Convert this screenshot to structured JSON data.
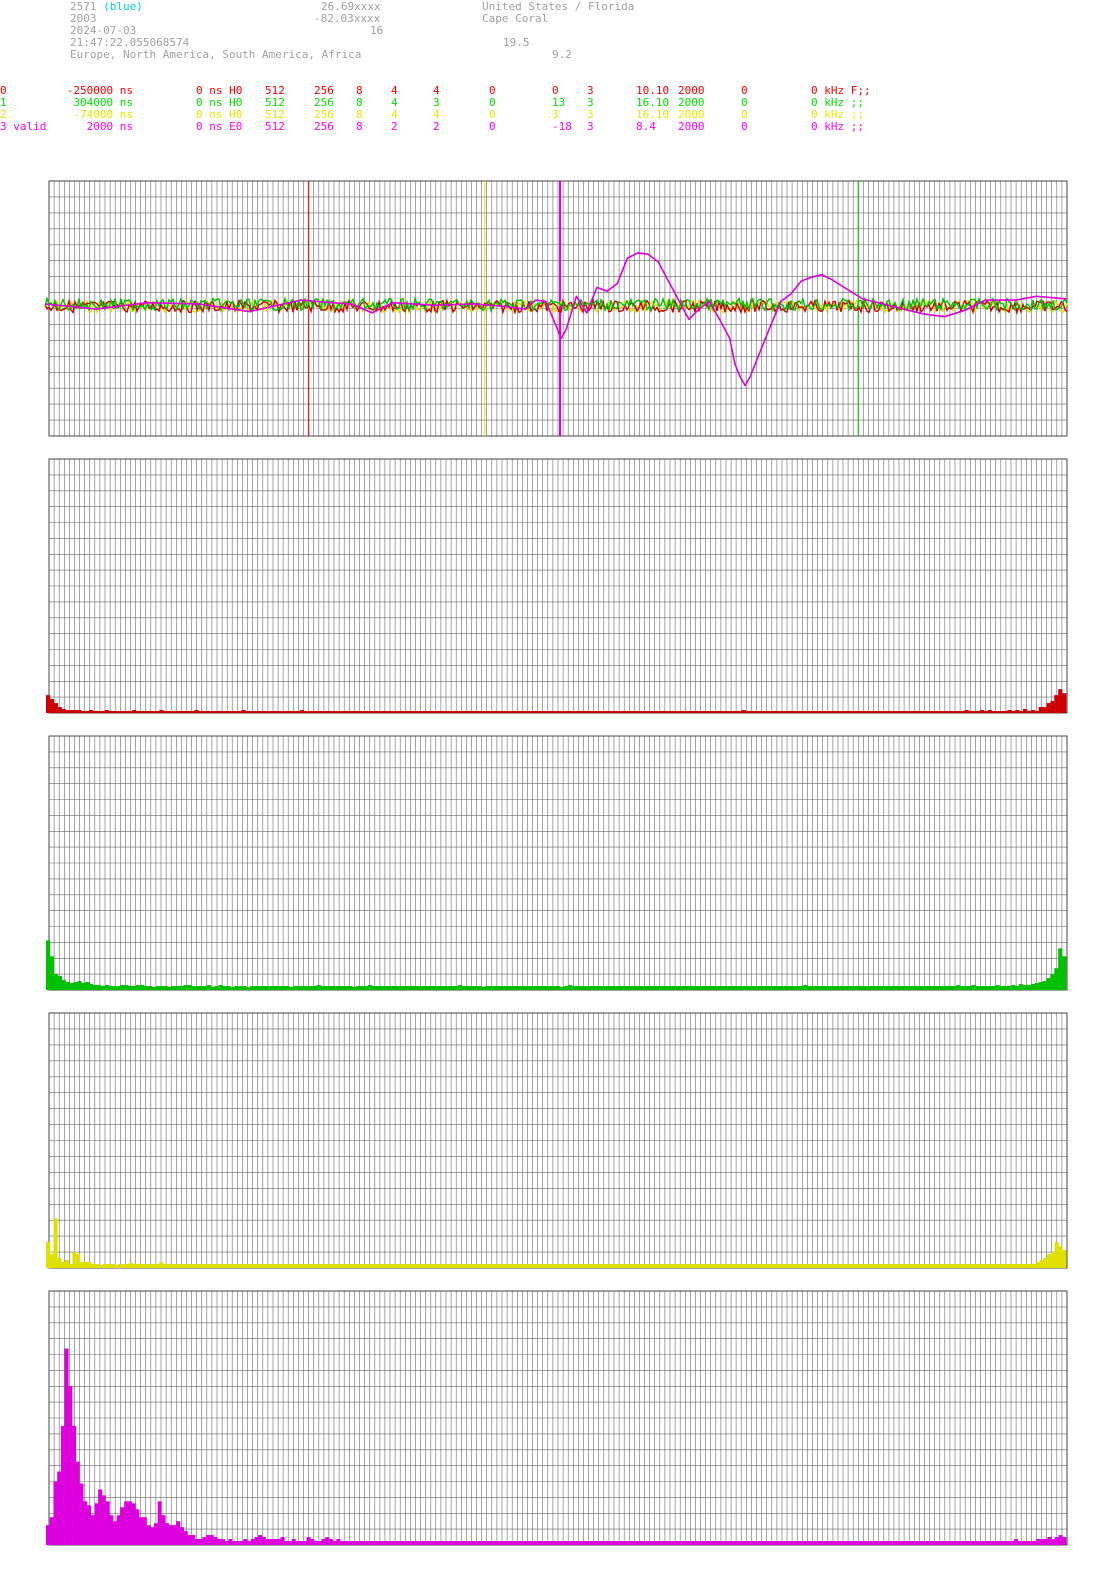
{
  "header": {
    "station_id": "2571",
    "station_tag": "(blue)",
    "station_num": "2003",
    "date": "2024-07-03",
    "time": "21:47:22.055068574",
    "regions": "Europe, North America, South America, Africa",
    "lat": "26.69xxxx",
    "lon": "-82.03xxxx",
    "val_a": "16",
    "country": "United States / Florida",
    "city": "Cape Coral",
    "val_b": "19.5",
    "val_c": "9.2"
  },
  "channels": [
    {
      "color": "#ff0000",
      "label": "0",
      "offset": "-250000 ns",
      "shift": "0 ns H0",
      "c1": "512",
      "c2": "256",
      "c3": "8",
      "c4": "4",
      "c5": "4",
      "c6": "0",
      "c7": "0",
      "c8": "3",
      "freq": "10.10",
      "bw": "2000",
      "c9": "0",
      "tail": "0 kHz F;;"
    },
    {
      "color": "#00e000",
      "label": "1",
      "offset": "304000 ns",
      "shift": "0 ns H0",
      "c1": "512",
      "c2": "256",
      "c3": "8",
      "c4": "4",
      "c5": "3",
      "c6": "0",
      "c7": "13",
      "c8": "3",
      "freq": "16.10",
      "bw": "2000",
      "c9": "0",
      "tail": "0 kHz ;;"
    },
    {
      "color": "#e8e800",
      "label": "2",
      "offset": "-74000 ns",
      "shift": "0 ns H0",
      "c1": "512",
      "c2": "256",
      "c3": "8",
      "c4": "4",
      "c5": "4",
      "c6": "0",
      "c7": "3",
      "c8": "3",
      "freq": "16.10",
      "bw": "2000",
      "c9": "0",
      "tail": "0 kHz ;;"
    },
    {
      "color": "#ff00ff",
      "label": "3 valid",
      "offset": "2000 ns",
      "shift": "0 ns E0",
      "c1": "512",
      "c2": "256",
      "c3": "8",
      "c4": "2",
      "c5": "2",
      "c6": "0",
      "c7": "-18",
      "c8": "3",
      "freq": "8.4",
      "bw": "2000",
      "c9": "0",
      "tail": "0 kHz ;;"
    }
  ],
  "colors": {
    "ch0": "#cc0000",
    "ch1": "#00c000",
    "ch2": "#e0e000",
    "ch3": "#dd00dd",
    "grid": "#555555",
    "bg": "#ffffff"
  },
  "chart_data": [
    {
      "type": "line",
      "markers": [
        {
          "channel": 0,
          "pos": 0.255
        },
        {
          "channel": 2,
          "pos": 0.428
        },
        {
          "channel": 3,
          "pos": 0.502
        },
        {
          "channel": 1,
          "pos": 0.795
        }
      ],
      "series": [
        {
          "channel": 3,
          "points": [
            [
              0,
              0.02
            ],
            [
              0.05,
              -0.02
            ],
            [
              0.1,
              0.03
            ],
            [
              0.15,
              0.02
            ],
            [
              0.2,
              -0.04
            ],
            [
              0.25,
              0.05
            ],
            [
              0.28,
              0.03
            ],
            [
              0.3,
              0.02
            ],
            [
              0.32,
              -0.05
            ],
            [
              0.34,
              0.03
            ],
            [
              0.38,
              0.01
            ],
            [
              0.42,
              0.02
            ],
            [
              0.45,
              0.0
            ],
            [
              0.47,
              -0.02
            ],
            [
              0.48,
              0.05
            ],
            [
              0.49,
              0.04
            ],
            [
              0.5,
              -0.15
            ],
            [
              0.505,
              -0.25
            ],
            [
              0.51,
              -0.18
            ],
            [
              0.52,
              0.08
            ],
            [
              0.53,
              -0.05
            ],
            [
              0.54,
              0.15
            ],
            [
              0.55,
              0.12
            ],
            [
              0.56,
              0.18
            ],
            [
              0.57,
              0.38
            ],
            [
              0.58,
              0.42
            ],
            [
              0.59,
              0.41
            ],
            [
              0.6,
              0.35
            ],
            [
              0.61,
              0.2
            ],
            [
              0.62,
              0.05
            ],
            [
              0.63,
              -0.1
            ],
            [
              0.64,
              -0.02
            ],
            [
              0.65,
              0.04
            ],
            [
              0.66,
              -0.1
            ],
            [
              0.67,
              -0.25
            ],
            [
              0.675,
              -0.45
            ],
            [
              0.68,
              -0.55
            ],
            [
              0.685,
              -0.62
            ],
            [
              0.69,
              -0.55
            ],
            [
              0.7,
              -0.35
            ],
            [
              0.71,
              -0.15
            ],
            [
              0.72,
              0.04
            ],
            [
              0.73,
              0.1
            ],
            [
              0.74,
              0.2
            ],
            [
              0.75,
              0.23
            ],
            [
              0.76,
              0.25
            ],
            [
              0.77,
              0.21
            ],
            [
              0.79,
              0.11
            ],
            [
              0.8,
              0.06
            ],
            [
              0.82,
              0.02
            ],
            [
              0.84,
              -0.02
            ],
            [
              0.86,
              -0.06
            ],
            [
              0.88,
              -0.08
            ],
            [
              0.9,
              -0.03
            ],
            [
              0.92,
              0.05
            ],
            [
              0.95,
              0.05
            ],
            [
              0.97,
              0.08
            ],
            [
              1.0,
              0.06
            ]
          ]
        }
      ]
    },
    {
      "type": "bar",
      "channel": 0,
      "values": [
        18,
        14,
        10,
        6,
        4,
        3,
        3,
        3,
        3,
        2,
        2,
        3,
        2,
        2,
        2,
        3,
        2,
        2,
        2,
        2,
        2,
        2,
        3,
        2,
        2,
        2,
        2,
        2,
        2,
        3,
        2,
        2,
        2,
        2,
        2,
        2,
        2,
        2,
        3,
        2,
        2,
        2,
        2,
        2,
        2,
        2,
        2,
        2,
        2,
        2,
        3,
        2,
        2,
        2,
        2,
        2,
        2,
        2,
        2,
        2,
        2,
        2,
        2,
        2,
        2,
        3,
        2,
        2,
        2,
        2,
        2,
        2,
        2,
        2,
        2,
        2,
        2,
        2,
        2,
        2,
        2,
        2,
        2,
        2,
        2,
        2,
        2,
        2,
        2,
        2,
        2,
        2,
        2,
        2,
        2,
        2,
        2,
        2,
        2,
        2,
        2,
        2,
        2,
        2,
        2,
        2,
        2,
        2,
        2,
        2,
        2,
        2,
        2,
        2,
        2,
        2,
        2,
        2,
        2,
        2,
        2,
        2,
        2,
        2,
        2,
        2,
        2,
        2,
        2,
        2,
        2,
        2,
        2,
        2,
        2,
        2,
        2,
        2,
        2,
        2,
        2,
        2,
        2,
        2,
        2,
        2,
        2,
        2,
        2,
        2,
        2,
        2,
        2,
        2,
        2,
        2,
        2,
        2,
        2,
        2,
        2,
        2,
        2,
        2,
        2,
        2,
        2,
        2,
        2,
        2,
        2,
        2,
        2,
        2,
        2,
        2,
        2,
        2,
        3,
        2,
        2,
        2,
        2,
        2,
        2,
        2,
        2,
        2,
        2,
        2,
        2,
        2,
        2,
        2,
        2,
        2,
        2,
        2,
        2,
        2,
        2,
        2,
        2,
        2,
        2,
        2,
        2,
        2,
        2,
        2,
        2,
        2,
        2,
        2,
        2,
        2,
        2,
        2,
        2,
        2,
        2,
        2,
        2,
        2,
        2,
        2,
        2,
        2,
        2,
        2,
        2,
        2,
        2,
        2,
        2,
        3,
        2,
        2,
        2,
        3,
        2,
        3,
        2,
        2,
        2,
        2,
        3,
        2,
        3,
        2,
        4,
        2,
        3,
        2,
        6,
        6,
        10,
        12,
        18,
        24,
        20
      ]
    },
    {
      "type": "bar",
      "channel": 1,
      "values": [
        50,
        34,
        16,
        14,
        10,
        8,
        7,
        8,
        9,
        7,
        8,
        6,
        5,
        5,
        4,
        5,
        4,
        4,
        4,
        5,
        5,
        4,
        4,
        5,
        5,
        4,
        4,
        3,
        4,
        4,
        4,
        3,
        4,
        4,
        4,
        5,
        5,
        4,
        4,
        4,
        4,
        5,
        3,
        4,
        5,
        4,
        4,
        3,
        4,
        4,
        4,
        3,
        4,
        4,
        4,
        4,
        4,
        4,
        4,
        4,
        4,
        4,
        3,
        4,
        4,
        4,
        4,
        4,
        4,
        5,
        4,
        4,
        4,
        4,
        4,
        4,
        4,
        4,
        3,
        4,
        4,
        4,
        5,
        4,
        4,
        4,
        4,
        4,
        4,
        4,
        4,
        4,
        4,
        4,
        4,
        4,
        4,
        4,
        4,
        4,
        4,
        4,
        4,
        4,
        4,
        5,
        4,
        4,
        4,
        4,
        4,
        3,
        4,
        4,
        4,
        4,
        4,
        4,
        4,
        4,
        4,
        4,
        4,
        4,
        4,
        4,
        4,
        4,
        4,
        4,
        4,
        3,
        4,
        5,
        4,
        4,
        4,
        4,
        4,
        4,
        4,
        4,
        4,
        4,
        4,
        4,
        4,
        4,
        4,
        4,
        4,
        4,
        4,
        4,
        4,
        4,
        4,
        4,
        4,
        4,
        4,
        4,
        4,
        4,
        4,
        4,
        4,
        4,
        4,
        4,
        4,
        4,
        4,
        4,
        4,
        4,
        4,
        4,
        4,
        4,
        4,
        4,
        4,
        4,
        4,
        4,
        4,
        4,
        4,
        4,
        4,
        4,
        4,
        5,
        4,
        4,
        4,
        4,
        4,
        4,
        4,
        4,
        4,
        4,
        4,
        4,
        4,
        4,
        4,
        4,
        4,
        4,
        4,
        4,
        4,
        4,
        4,
        4,
        4,
        4,
        4,
        4,
        4,
        4,
        4,
        4,
        4,
        4,
        4,
        4,
        4,
        4,
        5,
        4,
        4,
        4,
        5,
        4,
        4,
        4,
        4,
        4,
        5,
        4,
        4,
        4,
        5,
        4,
        6,
        5,
        5,
        6,
        7,
        8,
        9,
        12,
        16,
        22,
        42,
        34
      ]
    },
    {
      "type": "bar",
      "channel": 2,
      "values": [
        26,
        14,
        50,
        10,
        6,
        8,
        4,
        16,
        14,
        6,
        6,
        6,
        4,
        4,
        3,
        4,
        4,
        4,
        3,
        4,
        4,
        4,
        5,
        4,
        4,
        4,
        4,
        4,
        4,
        4,
        6,
        4,
        4,
        4,
        4,
        4,
        4,
        4,
        4,
        4,
        4,
        4,
        4,
        4,
        4,
        4,
        4,
        4,
        4,
        4,
        4,
        4,
        4,
        4,
        4,
        4,
        4,
        4,
        4,
        4,
        4,
        4,
        4,
        4,
        4,
        4,
        4,
        4,
        4,
        4,
        4,
        4,
        4,
        4,
        4,
        4,
        4,
        4,
        4,
        4,
        4,
        4,
        4,
        4,
        4,
        4,
        4,
        4,
        4,
        4,
        4,
        4,
        4,
        4,
        4,
        4,
        4,
        4,
        4,
        4,
        4,
        4,
        4,
        4,
        4,
        4,
        4,
        4,
        4,
        4,
        4,
        4,
        4,
        4,
        4,
        4,
        4,
        4,
        4,
        4,
        4,
        4,
        4,
        4,
        4,
        4,
        4,
        4,
        4,
        4,
        4,
        4,
        4,
        4,
        4,
        4,
        4,
        4,
        4,
        4,
        4,
        4,
        4,
        4,
        4,
        4,
        4,
        4,
        4,
        4,
        4,
        4,
        4,
        4,
        4,
        4,
        4,
        4,
        4,
        4,
        4,
        4,
        4,
        4,
        4,
        4,
        4,
        4,
        4,
        4,
        4,
        4,
        4,
        4,
        4,
        4,
        4,
        4,
        4,
        4,
        4,
        4,
        4,
        4,
        4,
        4,
        4,
        4,
        4,
        4,
        4,
        4,
        4,
        4,
        4,
        4,
        4,
        4,
        4,
        4,
        4,
        4,
        4,
        4,
        4,
        4,
        4,
        4,
        4,
        4,
        4,
        4,
        4,
        4,
        4,
        4,
        4,
        4,
        4,
        4,
        4,
        4,
        4,
        4,
        4,
        4,
        4,
        4,
        4,
        4,
        4,
        4,
        4,
        4,
        4,
        4,
        4,
        4,
        4,
        4,
        4,
        4,
        4,
        4,
        4,
        4,
        4,
        4,
        4,
        4,
        4,
        4,
        4,
        4,
        4,
        4,
        4,
        4,
        4,
        4,
        4,
        4,
        6,
        8,
        10,
        14,
        16,
        26,
        22,
        18
      ]
    },
    {
      "type": "bar",
      "channel": 3,
      "values": [
        20,
        28,
        64,
        74,
        120,
        198,
        160,
        120,
        84,
        62,
        44,
        40,
        30,
        42,
        56,
        50,
        44,
        30,
        24,
        30,
        38,
        44,
        44,
        42,
        36,
        28,
        28,
        20,
        18,
        22,
        44,
        30,
        22,
        20,
        20,
        24,
        18,
        14,
        10,
        10,
        6,
        6,
        8,
        10,
        10,
        8,
        6,
        6,
        4,
        6,
        4,
        4,
        4,
        6,
        4,
        6,
        8,
        10,
        8,
        6,
        6,
        6,
        6,
        8,
        4,
        4,
        6,
        4,
        4,
        4,
        8,
        6,
        4,
        4,
        6,
        8,
        6,
        4,
        6,
        4,
        4,
        4,
        4,
        4,
        4,
        4,
        4,
        4,
        4,
        4,
        4,
        4,
        4,
        4,
        4,
        4,
        4,
        4,
        4,
        4,
        4,
        4,
        4,
        4,
        4,
        4,
        4,
        4,
        4,
        4,
        4,
        4,
        4,
        4,
        4,
        4,
        4,
        4,
        4,
        4,
        4,
        4,
        4,
        4,
        4,
        4,
        4,
        4,
        4,
        4,
        4,
        4,
        4,
        4,
        4,
        4,
        4,
        4,
        4,
        4,
        4,
        4,
        4,
        4,
        4,
        4,
        4,
        4,
        4,
        4,
        4,
        4,
        4,
        4,
        4,
        4,
        4,
        4,
        4,
        4,
        4,
        4,
        4,
        4,
        4,
        4,
        4,
        4,
        4,
        4,
        4,
        4,
        4,
        4,
        4,
        4,
        4,
        4,
        4,
        4,
        4,
        4,
        4,
        4,
        4,
        4,
        4,
        4,
        4,
        4,
        4,
        4,
        4,
        4,
        4,
        4,
        4,
        4,
        4,
        4,
        4,
        4,
        4,
        4,
        4,
        4,
        4,
        4,
        4,
        4,
        4,
        4,
        4,
        4,
        4,
        4,
        4,
        4,
        4,
        4,
        4,
        4,
        4,
        4,
        4,
        4,
        4,
        4,
        4,
        4,
        4,
        4,
        4,
        4,
        4,
        4,
        4,
        4,
        4,
        4,
        4,
        4,
        4,
        4,
        4,
        4,
        4,
        4,
        4,
        4,
        4,
        4,
        4,
        4,
        4,
        4,
        4,
        4,
        4,
        4,
        6,
        4,
        4,
        4,
        4,
        4,
        6,
        6,
        6,
        8,
        6,
        8,
        10,
        8
      ]
    }
  ]
}
